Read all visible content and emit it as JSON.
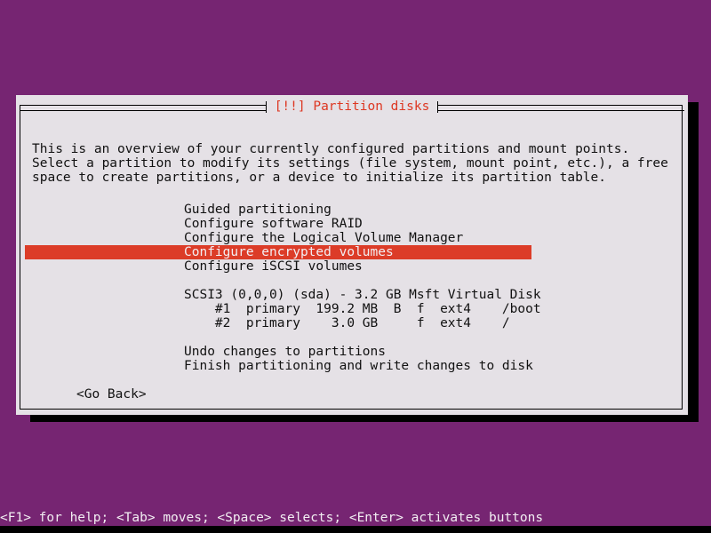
{
  "screen": {
    "background_color": "#762572",
    "text_color": "#f2eef2"
  },
  "dialog": {
    "title": "[!!] Partition disks",
    "title_color": "#dd3722",
    "background_color": "#e5e1e6",
    "border_color": "#000000",
    "description": "This is an overview of your currently configured partitions and mount points. Select a partition to modify its settings (file system, mount point, etc.), a free space to create partitions, or a device to initialize its partition table.",
    "menu_items": [
      {
        "label": "Guided partitioning",
        "selected": false
      },
      {
        "label": "Configure software RAID",
        "selected": false
      },
      {
        "label": "Configure the Logical Volume Manager",
        "selected": false
      },
      {
        "label": "Configure encrypted volumes",
        "selected": true
      },
      {
        "label": "Configure iSCSI volumes",
        "selected": false
      }
    ],
    "selection_color": "#dc3c28",
    "selection_text_color": "#f2eef2",
    "disk": {
      "header": "SCSI3 (0,0,0) (sda) - 3.2 GB Msft Virtual Disk",
      "partitions": [
        {
          "number": "#1",
          "type": "primary",
          "size": "199.2 MB",
          "flags": "B",
          "format": "f",
          "filesystem": "ext4",
          "mountpoint": "/boot",
          "line": "    #1  primary  199.2 MB  B  f  ext4    /boot"
        },
        {
          "number": "#2",
          "type": "primary",
          "size": "3.0 GB",
          "flags": "",
          "format": "f",
          "filesystem": "ext4",
          "mountpoint": "/",
          "line": "    #2  primary    3.0 GB     f  ext4    /"
        }
      ]
    },
    "actions": [
      {
        "label": "Undo changes to partitions"
      },
      {
        "label": "Finish partitioning and write changes to disk"
      }
    ],
    "buttons": [
      {
        "label": "<Go Back>"
      }
    ]
  },
  "statusbar": {
    "text": "<F1> for help; <Tab> moves; <Space> selects; <Enter> activates buttons"
  }
}
